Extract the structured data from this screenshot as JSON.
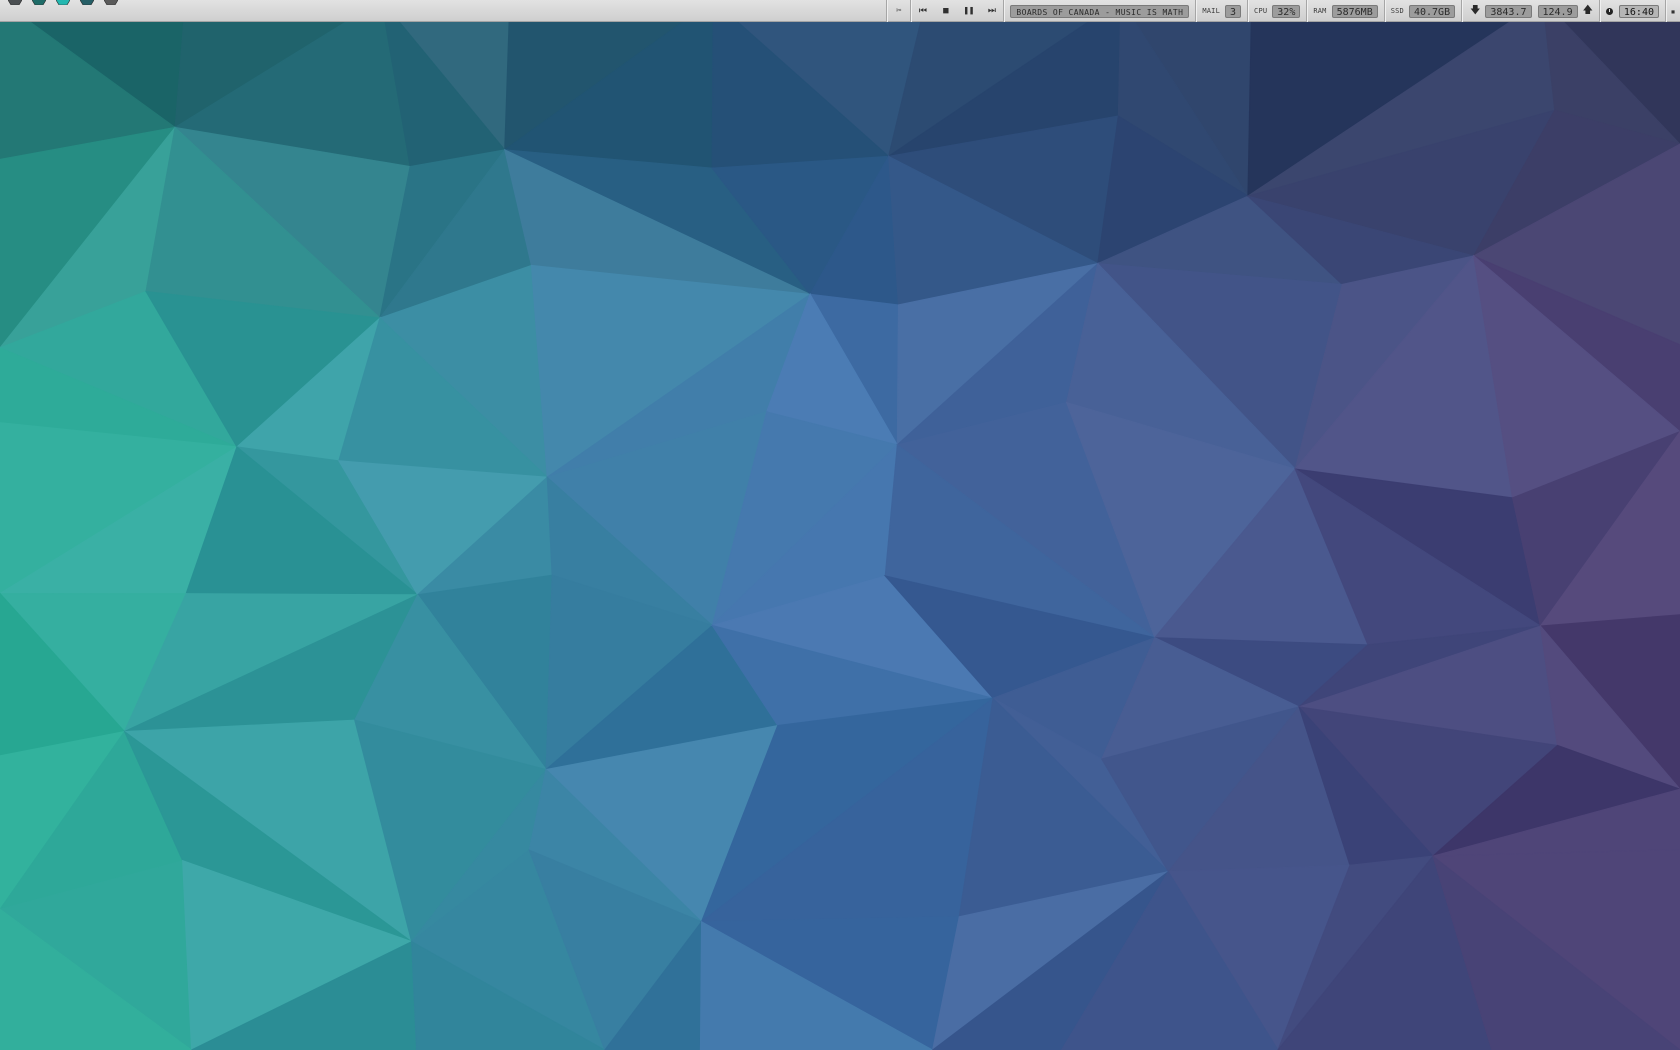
{
  "workspaces": [
    {
      "active": false,
      "color": "#4b4f52"
    },
    {
      "active": false,
      "color": "#1f6c68"
    },
    {
      "active": true,
      "color": "#24b7b0"
    },
    {
      "active": false,
      "color": "#265e66"
    },
    {
      "active": false,
      "color": "#5a5a5a"
    }
  ],
  "player": {
    "scissors_icon": "✂",
    "prev_icon": "⏮",
    "stop_icon": "■",
    "pause_icon": "❚❚",
    "next_icon": "⏭",
    "now_playing": "BOARDS OF CANADA - MUSIC IS MATH"
  },
  "stats": {
    "mail_label": "MAIL",
    "mail_value": "3",
    "cpu_label": "CPU",
    "cpu_value": "32%",
    "ram_label": "RAM",
    "ram_value": "5876MB",
    "ssd_label": "SSD",
    "ssd_value": "40.7GB",
    "down_icon": "🡇",
    "down_value": "3843.7",
    "up_value": "124.9",
    "up_icon": "🡅"
  },
  "clock": {
    "time": "16:40"
  },
  "colors": {
    "bar_bg": "#d6d6d6",
    "value_box": "#9c9c9c",
    "wallpaper_green": "#2fb39a",
    "wallpaper_blue": "#3f6fa8",
    "wallpaper_purple": "#4a3a6c"
  }
}
